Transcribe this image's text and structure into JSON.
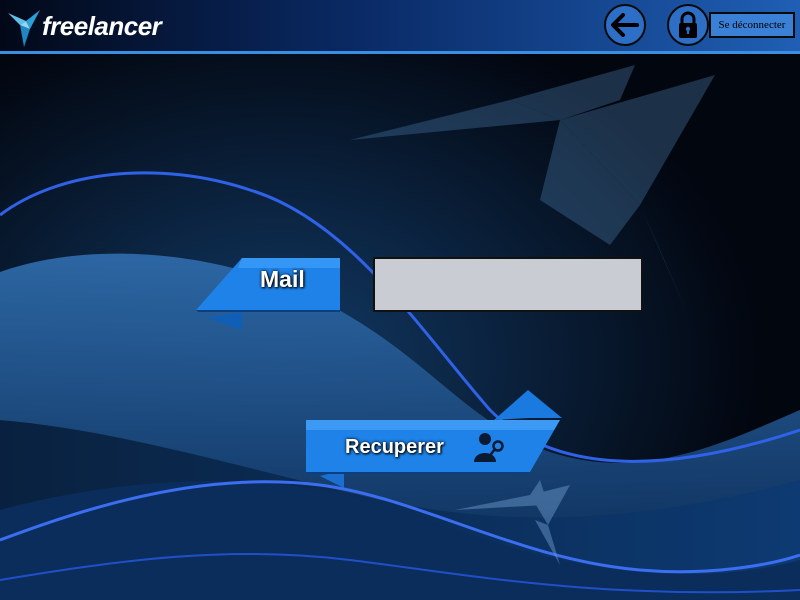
{
  "header": {
    "logo_text": "freelancer",
    "back_icon": "arrow-left-icon",
    "lock_icon": "lock-icon",
    "logout_label": "Se déconnecter"
  },
  "form": {
    "mail_label": "Mail",
    "mail_value": "",
    "recover_label": "Recuperer",
    "recover_icon": "user-key-icon"
  },
  "colors": {
    "accent_blue": "#1e7fe6",
    "header_light": "#1f5fb5",
    "input_bg": "#c9ccd2",
    "background": "#02060f"
  }
}
